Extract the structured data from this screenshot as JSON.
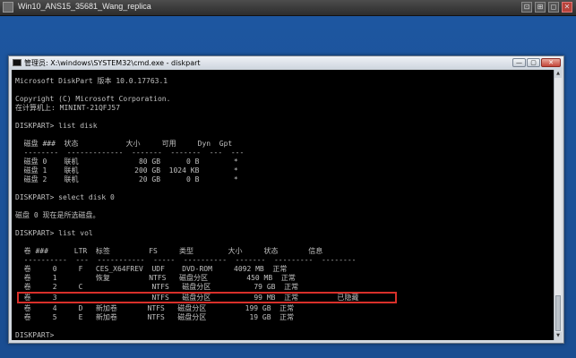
{
  "vm": {
    "title": "Win10_ANS15_35681_Wang_replica",
    "controls": [
      "⊡",
      "⊞",
      "◻",
      "✕"
    ]
  },
  "window": {
    "title": "管理员: X:\\windows\\SYSTEM32\\cmd.exe - diskpart",
    "controls": [
      "—",
      "▢",
      "✕"
    ]
  },
  "console": {
    "lines": [
      "Microsoft DiskPart 版本 10.0.17763.1",
      "",
      "Copyright (C) Microsoft Corporation.",
      "在计算机上: MININT-21QFJ57",
      "",
      "DISKPART> list disk",
      "",
      "  磁盘 ###  状态           大小     可用     Dyn  Gpt",
      "  --------  -------------  -------  -------  ---  ---",
      "  磁盘 0    联机              80 GB      0 B        *",
      "  磁盘 1    联机             200 GB  1024 KB        *",
      "  磁盘 2    联机              20 GB      0 B        *",
      "",
      "DISKPART> select disk 0",
      "",
      "磁盘 0 现在是所选磁盘。",
      "",
      "DISKPART> list vol",
      "",
      "  卷 ###      LTR  标签         FS     类型        大小     状态       信息",
      "  ----------  ---  -----------  -----  ----------  -------  ---------  --------",
      "  卷     0     F   CES_X64FREV  UDF    DVD-ROM     4092 MB  正常",
      "  卷     1         恢复         NTFS   磁盘分区         450 MB  正常",
      "  卷     2     C                NTFS   磁盘分区          79 GB  正常",
      "  卷     3                      NTFS   磁盘分区          99 MB  正常         已隐藏",
      "  卷     4     D   新加卷       NTFS   磁盘分区         199 GB  正常",
      "  卷     5     E   新加卷       NTFS   磁盘分区          19 GB  正常",
      "",
      "DISKPART>"
    ]
  },
  "colors": {
    "console_bg": "#000000",
    "console_text": "#c0c0c0",
    "highlight": "#d8302a",
    "desktop": "#1d56a0"
  }
}
